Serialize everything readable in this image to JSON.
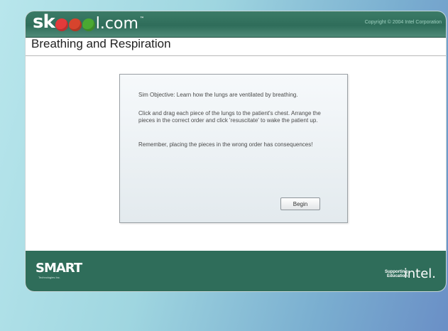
{
  "header": {
    "logo": {
      "prefix": "sk",
      "middle": "l.com",
      "balls": [
        "#e23a3a",
        "#d7442d",
        "#4aa832"
      ]
    },
    "copyright": "Copyright © 2004 Intel Corporation"
  },
  "page": {
    "title": "Breathing and Respiration"
  },
  "dialog": {
    "objective": "Sim Objective: Learn how the lungs are ventilated by breathing.",
    "instructions": "Click and drag each piece of the lungs to the patient's chest. Arrange the pieces in the correct order and click 'resuscitate' to wake the patient up.",
    "warning": "Remember, placing the pieces in the wrong order has consequences!",
    "begin_label": "Begin"
  },
  "footer": {
    "smart_logo": "SMART",
    "supporting": [
      "Supporting",
      "Education"
    ],
    "intel_logo": "intel."
  },
  "colors": {
    "header_green": "#2f6d5a",
    "slide_bg_left": "#b8e6ec",
    "slide_bg_right": "#6a8fc6"
  }
}
